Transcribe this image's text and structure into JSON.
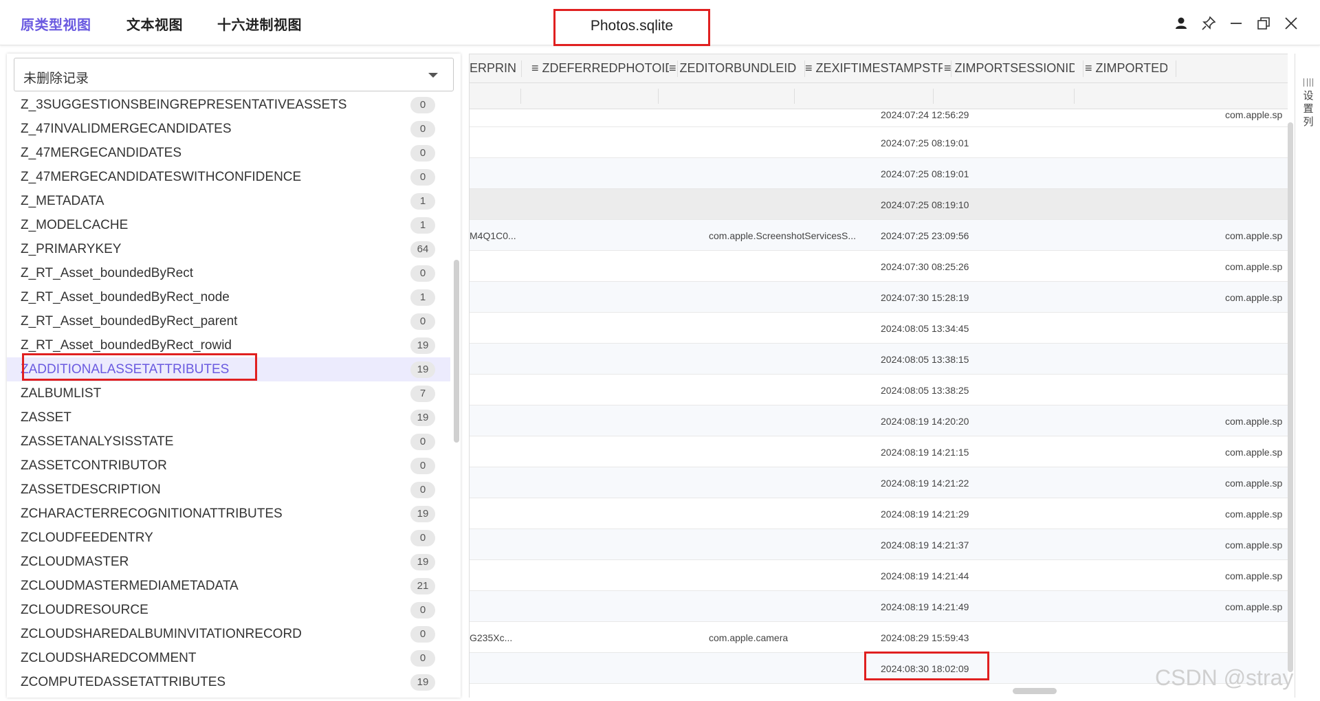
{
  "app": {
    "view_tabs": [
      "原类型视图",
      "文本视图",
      "十六进制视图"
    ],
    "title": "Photos.sqlite",
    "accent": "#6a5ae0",
    "highlight_color": "#e02020"
  },
  "window_controls": {
    "icons": [
      "user-icon",
      "pin-icon",
      "minimize-icon",
      "restore-icon",
      "close-icon"
    ]
  },
  "left": {
    "filter_select": "未删除记录",
    "tables": [
      {
        "name": "Z_3SUGGESTIONSBEINGREPRESENTATIVEASSETS",
        "count": "0"
      },
      {
        "name": "Z_47INVALIDMERGECANDIDATES",
        "count": "0"
      },
      {
        "name": "Z_47MERGECANDIDATES",
        "count": "0"
      },
      {
        "name": "Z_47MERGECANDIDATESWITHCONFIDENCE",
        "count": "0"
      },
      {
        "name": "Z_METADATA",
        "count": "1"
      },
      {
        "name": "Z_MODELCACHE",
        "count": "1"
      },
      {
        "name": "Z_PRIMARYKEY",
        "count": "64"
      },
      {
        "name": "Z_RT_Asset_boundedByRect",
        "count": "0"
      },
      {
        "name": "Z_RT_Asset_boundedByRect_node",
        "count": "1"
      },
      {
        "name": "Z_RT_Asset_boundedByRect_parent",
        "count": "0"
      },
      {
        "name": "Z_RT_Asset_boundedByRect_rowid",
        "count": "19"
      },
      {
        "name": "ZADDITIONALASSETATTRIBUTES",
        "count": "19",
        "selected": true
      },
      {
        "name": "ZALBUMLIST",
        "count": "7"
      },
      {
        "name": "ZASSET",
        "count": "19"
      },
      {
        "name": "ZASSETANALYSISSTATE",
        "count": "0"
      },
      {
        "name": "ZASSETCONTRIBUTOR",
        "count": "0"
      },
      {
        "name": "ZASSETDESCRIPTION",
        "count": "0"
      },
      {
        "name": "ZCHARACTERRECOGNITIONATTRIBUTES",
        "count": "19"
      },
      {
        "name": "ZCLOUDFEEDENTRY",
        "count": "0"
      },
      {
        "name": "ZCLOUDMASTER",
        "count": "19"
      },
      {
        "name": "ZCLOUDMASTERMEDIAMETADATA",
        "count": "21"
      },
      {
        "name": "ZCLOUDRESOURCE",
        "count": "0"
      },
      {
        "name": "ZCLOUDSHAREDALBUMINVITATIONRECORD",
        "count": "0"
      },
      {
        "name": "ZCLOUDSHAREDCOMMENT",
        "count": "0"
      },
      {
        "name": "ZCOMPUTEDASSETATTRIBUTES",
        "count": "19"
      }
    ]
  },
  "grid": {
    "columns": [
      "ERPRINT",
      "ZDEFERREDPHOTOIDENTIF",
      "ZEDITORBUNDLEID",
      "ZEXIFTIMESTAMPSTRING",
      "ZIMPORTSESSIONID",
      "ZIMPORTED"
    ],
    "rows": [
      {
        "c0": "",
        "c2": "",
        "c3": "2024:07:24 12:56:29",
        "c5": "com.apple.sp"
      },
      {
        "c0": "",
        "c2": "",
        "c3": "2024:07:25 08:19:01",
        "c5": ""
      },
      {
        "c0": "",
        "c2": "",
        "c3": "2024:07:25 08:19:01",
        "c5": ""
      },
      {
        "c0": "",
        "c2": "",
        "c3": "2024:07:25 08:19:10",
        "c5": ""
      },
      {
        "c0": "M4Q1C0...",
        "c2": "com.apple.ScreenshotServicesS...",
        "c3": "2024:07:25 23:09:56",
        "c5": "com.apple.sp"
      },
      {
        "c0": "",
        "c2": "",
        "c3": "2024:07:30 08:25:26",
        "c5": "com.apple.sp"
      },
      {
        "c0": "",
        "c2": "",
        "c3": "2024:07:30 15:28:19",
        "c5": "com.apple.sp"
      },
      {
        "c0": "",
        "c2": "",
        "c3": "2024:08:05 13:34:45",
        "c5": ""
      },
      {
        "c0": "",
        "c2": "",
        "c3": "2024:08:05 13:38:15",
        "c5": ""
      },
      {
        "c0": "",
        "c2": "",
        "c3": "2024:08:05 13:38:25",
        "c5": ""
      },
      {
        "c0": "",
        "c2": "",
        "c3": "2024:08:19 14:20:20",
        "c5": "com.apple.sp"
      },
      {
        "c0": "",
        "c2": "",
        "c3": "2024:08:19 14:21:15",
        "c5": "com.apple.sp"
      },
      {
        "c0": "",
        "c2": "",
        "c3": "2024:08:19 14:21:22",
        "c5": "com.apple.sp"
      },
      {
        "c0": "",
        "c2": "",
        "c3": "2024:08:19 14:21:29",
        "c5": "com.apple.sp"
      },
      {
        "c0": "",
        "c2": "",
        "c3": "2024:08:19 14:21:37",
        "c5": "com.apple.sp"
      },
      {
        "c0": "",
        "c2": "",
        "c3": "2024:08:19 14:21:44",
        "c5": "com.apple.sp"
      },
      {
        "c0": "",
        "c2": "",
        "c3": "2024:08:19 14:21:49",
        "c5": "com.apple.sp"
      },
      {
        "c0": "G235Xc...",
        "c2": "com.apple.camera",
        "c3": "2024:08:29 15:59:43",
        "c5": ""
      },
      {
        "c0": "",
        "c2": "",
        "c3": "2024:08:30 18:02:09",
        "c5": ""
      }
    ]
  },
  "settings_panel": {
    "label": "设置列"
  },
  "watermark": "CSDN @stray"
}
